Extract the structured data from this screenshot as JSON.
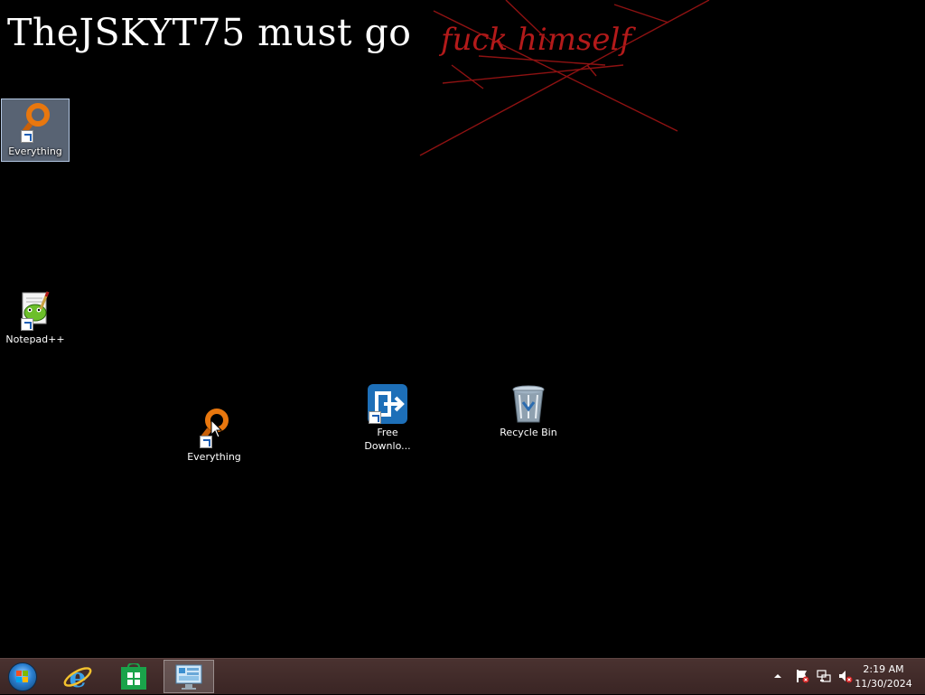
{
  "wallpaper": {
    "headline": "TheJSKYT75 must go",
    "scrawl": "fuck himself"
  },
  "desktop_icons": [
    {
      "label": "Everything",
      "icon": "everything-icon",
      "selected": true
    },
    {
      "label": "Notepad++",
      "icon": "notepadpp-icon"
    },
    {
      "label": "Everything",
      "icon": "everything-icon"
    },
    {
      "label": "Free Downlo...",
      "icon": "free-download-manager-icon"
    },
    {
      "label": "Recycle Bin",
      "icon": "recycle-bin-icon"
    }
  ],
  "taskbar": {
    "pinned": [
      {
        "name": "start-button",
        "icon": "windows-orb-icon"
      },
      {
        "name": "internet-explorer",
        "icon": "internet-explorer-icon"
      },
      {
        "name": "store",
        "icon": "windows-store-icon"
      },
      {
        "name": "control-panel",
        "icon": "control-panel-icon",
        "active": true
      }
    ],
    "tray": {
      "icons": [
        "show-hidden-icons-arrow",
        "action-center-flag-icon",
        "network-icon",
        "volume-muted-icon"
      ],
      "time": "2:19 AM",
      "date": "11/30/2024"
    }
  },
  "colors": {
    "desktop_bg": "#000000",
    "scrawl": "#b31a1a",
    "taskbar": "#3f2a29",
    "everything_orange": "#e8770e"
  }
}
